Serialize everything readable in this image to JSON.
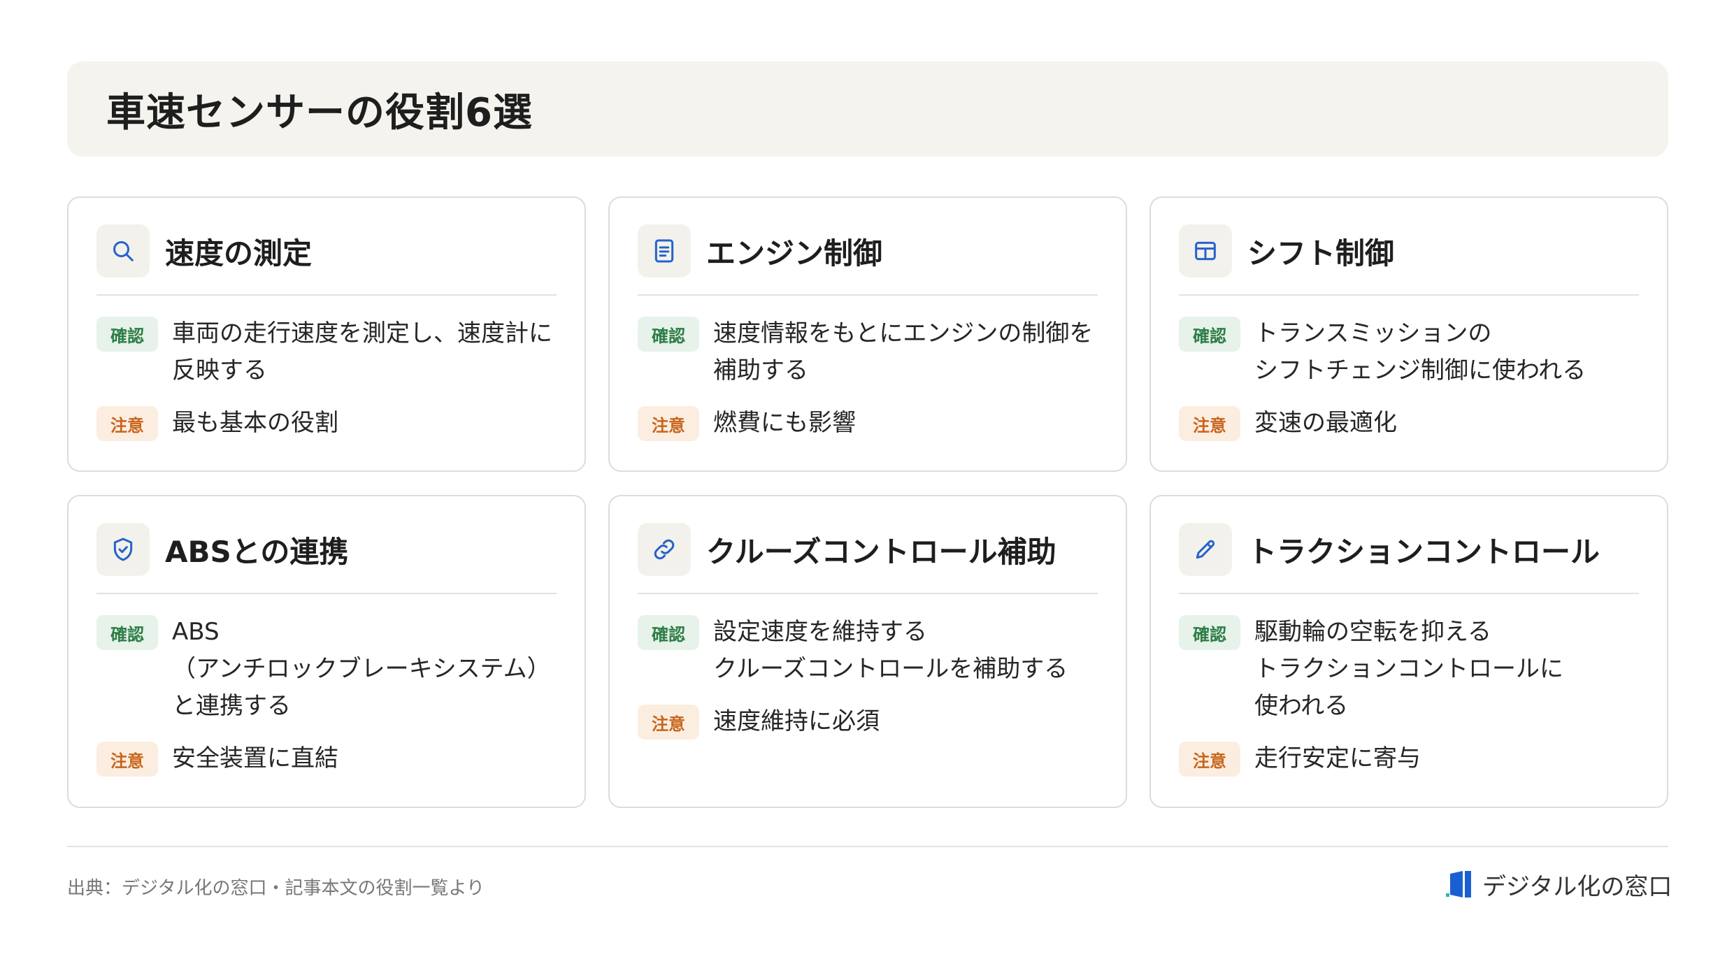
{
  "page": {
    "title": "車速センサーの役割6選"
  },
  "badges": {
    "confirm": "確認",
    "note": "注意"
  },
  "cards": [
    {
      "title": "速度の測定",
      "icon": "search-icon",
      "confirm": "車両の走行速度を測定し、速度計に\n反映する",
      "note": "最も基本の役割"
    },
    {
      "title": "エンジン制御",
      "icon": "document-icon",
      "confirm": "速度情報をもとにエンジンの制御を\n補助する",
      "note": "燃費にも影響"
    },
    {
      "title": "シフト制御",
      "icon": "grid-icon",
      "confirm": "トランスミッションの\nシフトチェンジ制御に使われる",
      "note": "変速の最適化"
    },
    {
      "title": "ABSとの連携",
      "icon": "shield-check-icon",
      "confirm": "ABS\n（アンチロックブレーキシステム）\nと連携する",
      "note": "安全装置に直結"
    },
    {
      "title": "クルーズコントロール補助",
      "icon": "link-icon",
      "confirm": "設定速度を維持する\nクルーズコントロールを補助する",
      "note": "速度維持に必須"
    },
    {
      "title": "トラクションコントロール",
      "icon": "pencil-icon",
      "confirm": "駆動輪の空転を抑える\nトラクションコントロールに\n使われる",
      "note": "走行安定に寄与"
    }
  ],
  "footer": {
    "source": "出典：デジタル化の窓口・記事本文の役割一覧より",
    "brand": "デジタル化の窓口",
    "brand_icon": "logo-icon"
  },
  "colors": {
    "icon_blue": "#2563c9",
    "confirm_text": "#2e7d46",
    "note_text": "#c8641c"
  }
}
